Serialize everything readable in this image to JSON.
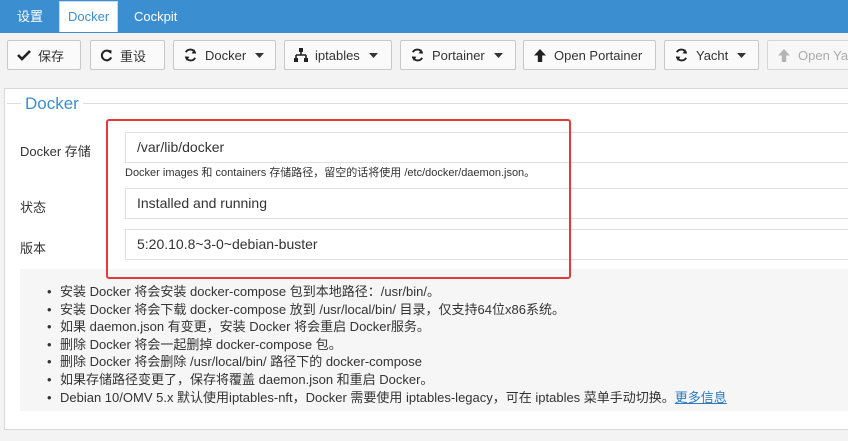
{
  "tabs": [
    {
      "label": "设置"
    },
    {
      "label": "Docker"
    },
    {
      "label": "Cockpit"
    }
  ],
  "toolbar": {
    "save": "保存",
    "reset": "重设",
    "docker": "Docker",
    "iptables": "iptables",
    "portainer": "Portainer",
    "open_portainer": "Open Portainer",
    "yacht": "Yacht",
    "open_yacht": "Open Yac"
  },
  "section": {
    "title": "Docker",
    "storage_label": "Docker 存储",
    "storage_value": "/var/lib/docker",
    "storage_hint": "Docker images 和 containers 存储路径，留空的话将使用 /etc/docker/daemon.json。",
    "status_label": "状态",
    "status_value": "Installed and running",
    "version_label": "版本",
    "version_value": "5:20.10.8~3-0~debian-buster"
  },
  "notes": [
    "安装 Docker 将会安装 docker-compose 包到本地路径：/usr/bin/。",
    "安装 Docker 将会下载 docker-compose 放到 /usr/local/bin/ 目录，仅支持64位x86系统。",
    "如果 daemon.json 有变更，安装 Docker 将会重启 Docker服务。",
    "删除 Docker 将会一起删掉 docker-compose 包。",
    "删除 Docker 将会删除 /usr/local/bin/ 路径下的 docker-compose",
    "如果存储路径变更了，保存将覆盖 daemon.json 和重启 Docker。",
    "Debian 10/OMV 5.x 默认使用iptables-nft，Docker 需要使用 iptables-legacy，可在 iptables 菜单手动切换。"
  ],
  "more_info": "更多信息",
  "colors": {
    "accent": "#3b8fd1",
    "highlight": "#e5393b"
  }
}
